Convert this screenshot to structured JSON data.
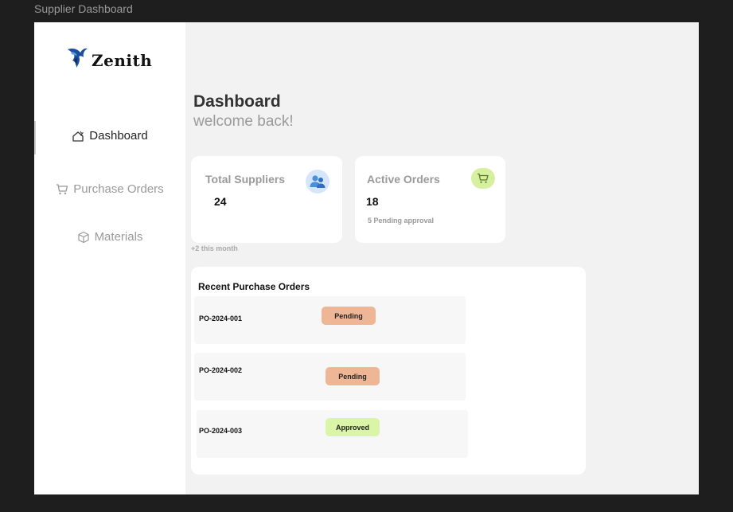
{
  "window": {
    "frame_label": "Supplier Dashboard"
  },
  "brand": {
    "name": "Zenith"
  },
  "sidebar": {
    "items": [
      {
        "label": "Dashboard",
        "icon": "home-icon",
        "active": true
      },
      {
        "label": "Purchase Orders",
        "icon": "cart-icon",
        "active": false
      },
      {
        "label": "Materials",
        "icon": "box-icon",
        "active": false
      }
    ]
  },
  "header": {
    "title": "Dashboard",
    "subtitle": "welcome back!"
  },
  "stats": {
    "suppliers": {
      "title": "Total Suppliers",
      "value": "24",
      "note": "+2 this month",
      "icon": "users-icon",
      "icon_color": "#4a8fdc",
      "icon_bg": "#dbe9fa"
    },
    "orders": {
      "title": "Active Orders",
      "value": "18",
      "note": "5 Pending approval",
      "icon": "cart-icon",
      "icon_color": "#5a7a2a",
      "icon_bg": "#d6f0a0"
    }
  },
  "recent": {
    "title": "Recent Purchase Orders",
    "rows": [
      {
        "id": "PO-2024-001",
        "status": "Pending"
      },
      {
        "id": "PO-2024-002",
        "status": "Pending"
      },
      {
        "id": "PO-2024-003",
        "status": "Approved"
      }
    ]
  },
  "colors": {
    "pending": "#efb696",
    "approved": "#daf5a8",
    "sidebar_bg": "#ffffff",
    "content_bg": "#f2f2f2"
  }
}
